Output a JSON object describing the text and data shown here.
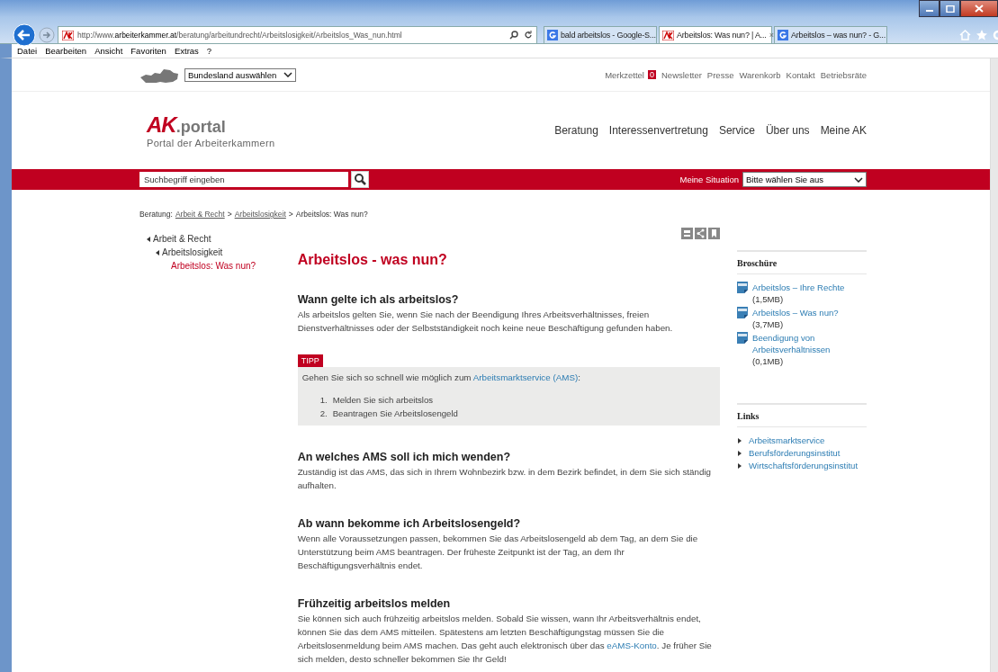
{
  "browser": {
    "address": {
      "prefix": "http://www.",
      "domain": "arbeiterkammer.at",
      "path": "/beratung/arbeitundrecht/Arbeitslosigkeit/Arbeitslos_Was_nun.html"
    },
    "tabs": [
      {
        "title": "bald arbeitslos - Google-S...",
        "kind": "google",
        "selected": false
      },
      {
        "title": "Arbeitslos: Was nun? | A...",
        "kind": "ak",
        "selected": true,
        "close": "×"
      },
      {
        "title": "Arbeitslos – was nun? - G...",
        "kind": "google",
        "selected": false
      }
    ],
    "menu": [
      "Datei",
      "Bearbeiten",
      "Ansicht",
      "Favoriten",
      "Extras",
      "?"
    ]
  },
  "topbar": {
    "region_select": "Bundesland auswählen",
    "merkzettel": {
      "label": "Merkzettel",
      "count": "0"
    },
    "links": [
      "Newsletter",
      "Presse",
      "Warenkorb",
      "Kontakt",
      "Betriebsräte"
    ]
  },
  "logo": {
    "mark": "AK",
    "word": ".portal",
    "tagline": "Portal der Arbeiterkammern"
  },
  "nav": [
    "Beratung",
    "Interessenvertretung",
    "Service",
    "Über uns",
    "Meine AK"
  ],
  "searchbar": {
    "placeholder": "Suchbegriff eingeben",
    "situation_label": "Meine Situation",
    "situation_select": "Bitte wählen Sie aus"
  },
  "breadcrumb": {
    "label": "Beratung:",
    "links": [
      "Arbeit & Recht",
      "Arbeitslosigkeit"
    ],
    "current": "Arbeitslos: Was nun?",
    "separators": [
      ">",
      ">"
    ]
  },
  "sidenav": [
    {
      "label": "Arbeit & Recht",
      "selected": false,
      "children": [
        {
          "label": "Arbeitslosigkeit",
          "selected": false,
          "children": [
            {
              "label": "Arbeitslos: Was nun?",
              "selected": true
            }
          ]
        }
      ]
    }
  ],
  "article": {
    "title": "Arbeitslos - was nun?",
    "sections": [
      {
        "heading": "Wann gelte ich als arbeitslos?",
        "text": {
          "before": "Als arbeitslos gelten Sie, wenn Sie nach der Beendigung Ihres Arbeitsverhältnisses, freien Dienstverhältnisses oder der Selbstständigkeit noch keine neue Beschäftigung gefunden haben."
        },
        "tip": {
          "badge": "TIPP",
          "text": {
            "before": "Gehen Sie sich so schnell wie möglich zum ",
            "link": "Arbeitsmarktservice (AMS)",
            "after": ":"
          },
          "steps": [
            {
              "n": "1.",
              "t": "Melden Sie sich arbeitslos"
            },
            {
              "n": "2.",
              "t": "Beantragen Sie Arbeitslosengeld"
            }
          ]
        }
      },
      {
        "heading": "An welches AMS soll ich mich wenden?",
        "text": {
          "before": "Zuständig ist das AMS, das sich in Ihrem Wohnbezirk bzw. in dem Bezirk befindet, in dem Sie sich ständig aufhalten."
        }
      },
      {
        "heading": "Ab wann bekomme ich Arbeitslosengeld?",
        "text": {
          "before": "Wenn alle Voraussetzungen passen, bekommen Sie das Arbeitslosengeld ab dem Tag, an dem Sie die Unterstützung beim AMS beantragen. Der früheste Zeitpunkt ist der Tag, an dem Ihr Beschäftigungsverhältnis endet."
        }
      },
      {
        "heading": "Frühzeitig arbeitslos melden",
        "text": {
          "before": "Sie können sich auch frühzeitig arbeitslos melden. Sobald Sie wissen, wann Ihr Arbeitsverhältnis endet, können Sie das dem AMS mitteilen. Spätestens am letzten Beschäftigungstag müssen Sie die Arbeitslosenmeldung beim AMS machen. Das geht auch elektronisch über das ",
          "link": "eAMS-Konto",
          "after": ". Je früher Sie sich melden, desto schneller bekommen Sie Ihr Geld!"
        }
      }
    ]
  },
  "brochures": {
    "title": "Broschüre",
    "items": [
      {
        "title": "Arbeitslos – Ihre Rechte",
        "size": "(1,5MB)"
      },
      {
        "title": "Arbeitslos – Was nun?",
        "size": "(3,7MB)"
      },
      {
        "title": "Beendigung von Arbeitsverhältnissen",
        "size": "(0,1MB)"
      }
    ]
  },
  "links": {
    "title": "Links",
    "items": [
      "Arbeitsmarktservice",
      "Berufsförderungsinstitut",
      "Wirtschaftsförderungsinstitut"
    ]
  }
}
